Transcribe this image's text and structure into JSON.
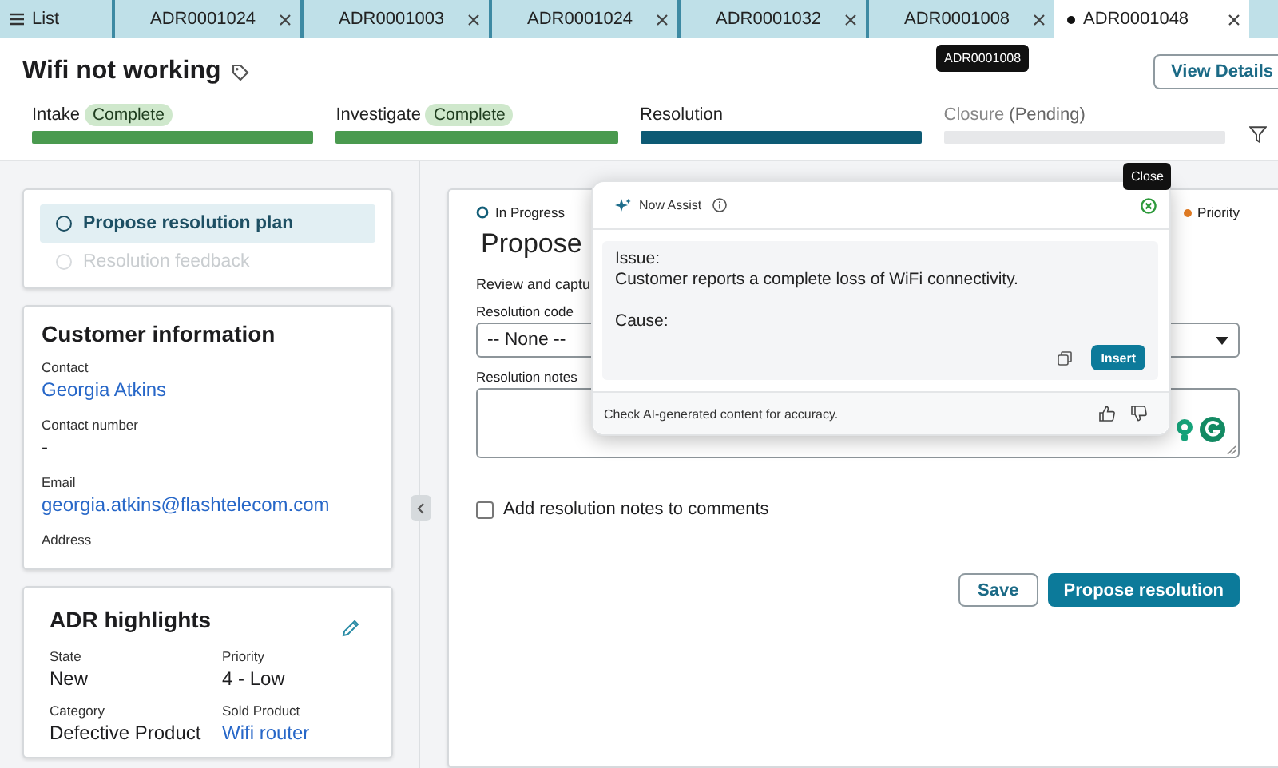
{
  "tabs": [
    {
      "label": "List",
      "kind": "list",
      "selected": false,
      "modified": false
    },
    {
      "label": "ADR0001024",
      "kind": "record",
      "selected": false,
      "modified": false
    },
    {
      "label": "ADR0001003",
      "kind": "record",
      "selected": false,
      "modified": false
    },
    {
      "label": "ADR0001024",
      "kind": "record",
      "selected": false,
      "modified": false
    },
    {
      "label": "ADR0001032",
      "kind": "record",
      "selected": false,
      "modified": false
    },
    {
      "label": "ADR0001008",
      "kind": "record",
      "selected": false,
      "modified": false
    },
    {
      "label": "ADR0001048",
      "kind": "record",
      "selected": true,
      "modified": true
    }
  ],
  "tab_tooltip": "ADR0001008",
  "record": {
    "title": "Wifi not working",
    "view_details": "View Details"
  },
  "stages": [
    {
      "label": "Intake",
      "badge": "Complete",
      "complete": true,
      "selected": false
    },
    {
      "label": "Investigate",
      "badge": "Complete",
      "complete": true,
      "selected": false
    },
    {
      "label": "Resolution",
      "complete": false,
      "selected": true
    },
    {
      "label": "Closure",
      "note": "(Pending)",
      "complete": false,
      "selected": false
    }
  ],
  "steps": [
    {
      "label": "Propose resolution plan",
      "selected": true,
      "disabled": false
    },
    {
      "label": "Resolution feedback",
      "selected": false,
      "disabled": true
    }
  ],
  "customer": {
    "title": "Customer information",
    "fields": [
      {
        "label": "Contact",
        "value": "Georgia Atkins",
        "kind": "link"
      },
      {
        "label": "Contact number",
        "value": "-",
        "kind": "text"
      },
      {
        "label": "Email",
        "value": "georgia.atkins@flashtelecom.com",
        "kind": "link"
      },
      {
        "label": "Address"
      }
    ]
  },
  "highlights": {
    "title": "ADR highlights",
    "fields": [
      {
        "label": "State",
        "value": "New",
        "kind": "text"
      },
      {
        "label": "Priority",
        "value": "4 - Low",
        "kind": "text"
      },
      {
        "label": "Category",
        "value": "Defective Product",
        "kind": "text"
      },
      {
        "label": "Sold Product",
        "value": "Wifi router",
        "kind": "link"
      }
    ]
  },
  "task": {
    "status": "In Progress",
    "priority": "Priority",
    "heading": "Propose",
    "intro": "Review and captu",
    "resolution_code": {
      "label": "Resolution code",
      "value": "-- None --"
    },
    "resolution_notes": {
      "label": "Resolution notes"
    },
    "comment_option": {
      "label": "Add resolution notes to comments",
      "checked": false
    },
    "buttons": [
      {
        "label": "Save",
        "kind": "secondary"
      },
      {
        "label": "Propose resolution",
        "kind": "primary"
      }
    ]
  },
  "assist": {
    "title": "Now Assist",
    "close_tooltip": "Close",
    "paragraphs": [
      "Issue:\nCustomer reports a complete loss of WiFi connectivity.",
      "Cause:"
    ],
    "insert": "Insert",
    "disclaimer": "Check AI-generated content for accuracy."
  }
}
